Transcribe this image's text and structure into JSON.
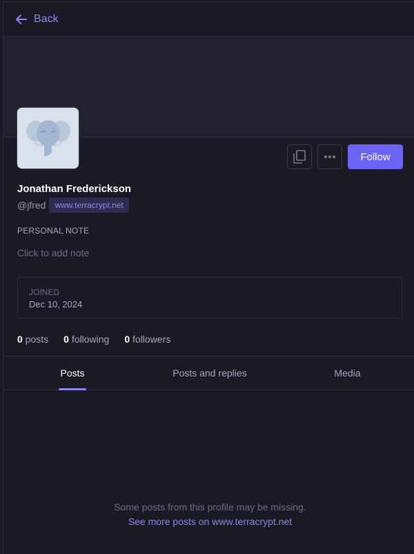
{
  "topbar": {
    "back_label": "Back"
  },
  "profile": {
    "name": "Jonathan Frederickson",
    "handle": "@jfred",
    "domain": "www.terracrypt.net",
    "avatar_icon": "elephant-icon"
  },
  "actions": {
    "copy_icon": "copy-icon",
    "more_icon": "more-icon",
    "follow_label": "Follow"
  },
  "note": {
    "label": "PERSONAL NOTE",
    "placeholder": "Click to add note"
  },
  "joined": {
    "label": "JOINED",
    "date": "Dec 10, 2024"
  },
  "stats": [
    {
      "count": "0",
      "label": "posts"
    },
    {
      "count": "0",
      "label": "following"
    },
    {
      "count": "0",
      "label": "followers"
    }
  ],
  "tabs": [
    {
      "label": "Posts",
      "active": true
    },
    {
      "label": "Posts and replies",
      "active": false
    },
    {
      "label": "Media",
      "active": false
    }
  ],
  "empty_state": {
    "missing_text": "Some posts from this profile may be missing.",
    "see_more_prefix": "See more posts on ",
    "see_more_link": "www.terracrypt.net"
  },
  "colors": {
    "accent": "#6a63f6",
    "link": "#8b86f0",
    "background": "#191a23",
    "banner": "#21222d"
  }
}
